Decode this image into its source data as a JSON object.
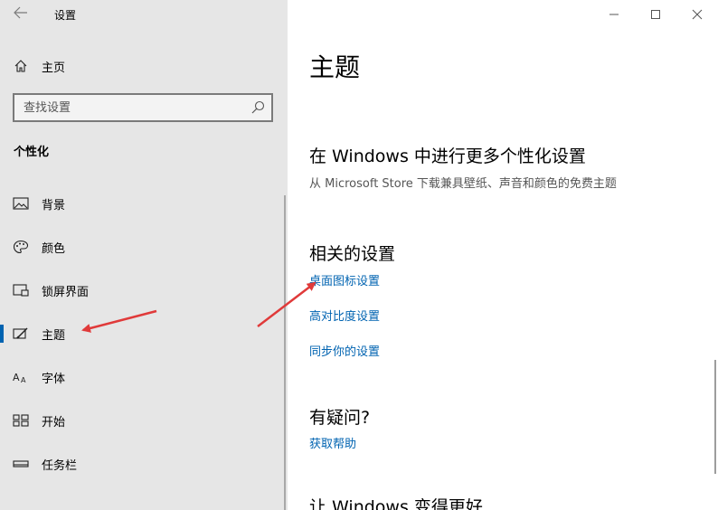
{
  "window": {
    "title": "设置",
    "back_icon": "back-arrow-icon",
    "minimize_icon": "minimize-icon",
    "maximize_icon": "maximize-icon",
    "close_icon": "close-icon"
  },
  "sidebar": {
    "home_label": "主页",
    "search_placeholder": "查找设置",
    "section_title": "个性化",
    "items": [
      {
        "label": "背景",
        "icon": "picture-icon",
        "selected": false
      },
      {
        "label": "颜色",
        "icon": "palette-icon",
        "selected": false
      },
      {
        "label": "锁屏界面",
        "icon": "lock-screen-icon",
        "selected": false
      },
      {
        "label": "主题",
        "icon": "theme-brush-icon",
        "selected": true
      },
      {
        "label": "字体",
        "icon": "font-icon",
        "selected": false
      },
      {
        "label": "开始",
        "icon": "start-grid-icon",
        "selected": false
      },
      {
        "label": "任务栏",
        "icon": "taskbar-icon",
        "selected": false
      }
    ]
  },
  "main": {
    "page_title": "主题",
    "more_personalization": {
      "heading": "在 Windows 中进行更多个性化设置",
      "description": "从 Microsoft Store 下载兼具壁纸、声音和颜色的免费主题"
    },
    "related_settings": {
      "heading": "相关的设置",
      "links": [
        "桌面图标设置",
        "高对比度设置",
        "同步你的设置"
      ]
    },
    "questions": {
      "heading": "有疑问?",
      "link": "获取帮助"
    },
    "improve": {
      "heading": "让 Windows 变得更好"
    }
  },
  "colors": {
    "accent": "#0063b1",
    "sidebar_bg": "#e6e6e6",
    "annotation_arrow": "#e03a3a"
  }
}
